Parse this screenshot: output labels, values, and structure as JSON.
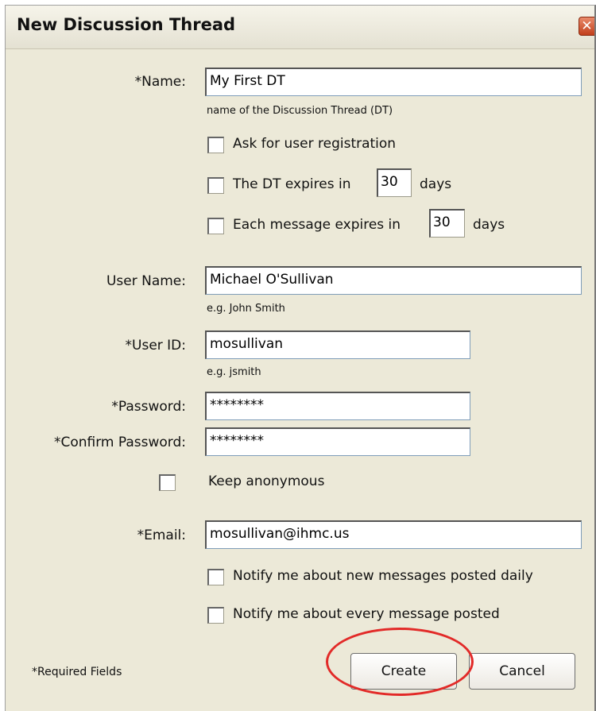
{
  "dialog": {
    "title": "New Discussion Thread",
    "close_icon_glyph": "✕"
  },
  "form": {
    "name": {
      "label": "*Name:",
      "value": "My First DT",
      "hint": "name of the Discussion Thread (DT)"
    },
    "ask_registration": {
      "label": "Ask for user registration",
      "checked": false
    },
    "dt_expires": {
      "prefix": "The DT expires in",
      "value": "30",
      "suffix": "days",
      "checked": false
    },
    "msg_expires": {
      "prefix": "Each message expires in",
      "value": "30",
      "suffix": "days",
      "checked": false
    },
    "user_name": {
      "label": "User Name:",
      "value": "Michael O'Sullivan",
      "hint": "e.g. John Smith"
    },
    "user_id": {
      "label": "*User ID:",
      "value": "mosullivan",
      "hint": "e.g. jsmith"
    },
    "password": {
      "label": "*Password:",
      "value": "********"
    },
    "confirm_password": {
      "label": "*Confirm Password:",
      "value": "********"
    },
    "keep_anonymous": {
      "label": "Keep anonymous",
      "checked": false
    },
    "email": {
      "label": "*Email:",
      "value": "mosullivan@ihmc.us"
    },
    "notify_daily": {
      "label": "Notify me about new messages posted daily",
      "checked": false
    },
    "notify_every": {
      "label": "Notify me about every message posted",
      "checked": false
    }
  },
  "footer": {
    "required_note": "*Required Fields",
    "create_label": "Create",
    "cancel_label": "Cancel"
  },
  "colors": {
    "dialog_bg": "#ece9d8",
    "highlight_circle": "#e22a28"
  }
}
